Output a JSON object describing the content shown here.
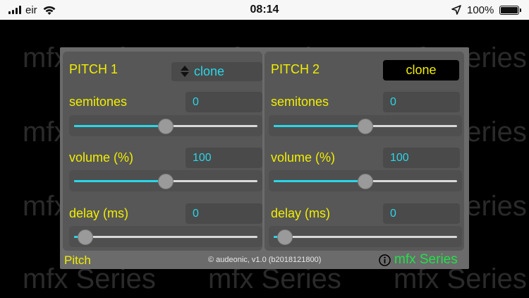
{
  "status_bar": {
    "carrier": "eir",
    "time": "08:14",
    "battery": "100%"
  },
  "watermark": "mfx Series",
  "pitch1": {
    "title": "PITCH 1",
    "clone_label": "clone",
    "params": [
      {
        "label": "semitones",
        "value": "0",
        "level": 0.5
      },
      {
        "label": "volume (%)",
        "value": "100",
        "level": 0.5
      },
      {
        "label": "delay (ms)",
        "value": "0",
        "level": 0.06
      }
    ]
  },
  "pitch2": {
    "title": "PITCH 2",
    "clone_label": "clone",
    "params": [
      {
        "label": "semitones",
        "value": "0",
        "level": 0.5
      },
      {
        "label": "volume (%)",
        "value": "100",
        "level": 0.5
      },
      {
        "label": "delay (ms)",
        "value": "0",
        "level": 0.06
      }
    ]
  },
  "footer": {
    "plugin_name": "Pitch",
    "copyright": "© audeonic, v1.0 (b2018121800)",
    "brand": "mfx Series"
  },
  "colors": {
    "label_yellow": "#f1ee00",
    "value_cyan": "#29d6e8",
    "brand_green": "#22e04a"
  }
}
